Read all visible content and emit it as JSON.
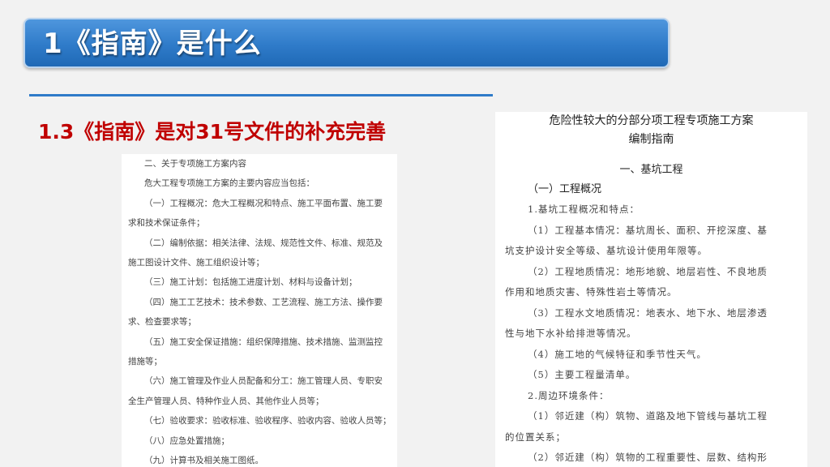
{
  "slide": {
    "title": "1《指南》是什么",
    "subtitle": "1.3《指南》是对31号文件的补充完善"
  },
  "left_doc": {
    "lines": [
      {
        "text": "二、关于专项施工方案内容",
        "indent": true
      },
      {
        "text": "危大工程专项施工方案的主要内容应当包括：",
        "indent": true
      },
      {
        "text": "（一）工程概况：危大工程概况和特点、施工平面布置、施工要",
        "indent": true
      },
      {
        "text": "求和技术保证条件；",
        "indent": false
      },
      {
        "text": "（二）编制依据：相关法律、法规、规范性文件、标准、规范及",
        "indent": true
      },
      {
        "text": "施工图设计文件、施工组织设计等；",
        "indent": false
      },
      {
        "text": "（三）施工计划：包括施工进度计划、材料与设备计划；",
        "indent": true
      },
      {
        "text": "（四）施工工艺技术：技术参数、工艺流程、施工方法、操作要",
        "indent": true
      },
      {
        "text": "求、检查要求等；",
        "indent": false
      },
      {
        "text": "（五）施工安全保证措施：组织保障措施、技术措施、监测监控",
        "indent": true
      },
      {
        "text": "措施等；",
        "indent": false
      },
      {
        "text": "（六）施工管理及作业人员配备和分工：施工管理人员、专职安",
        "indent": true
      },
      {
        "text": "全生产管理人员、特种作业人员、其他作业人员等；",
        "indent": false
      },
      {
        "text": "（七）验收要求：验收标准、验收程序、验收内容、验收人员等；",
        "indent": true
      },
      {
        "text": "（八）应急处置措施；",
        "indent": true
      },
      {
        "text": "（九）计算书及相关施工图纸。",
        "indent": true
      }
    ]
  },
  "right_doc": {
    "title_line1": "危险性较大的分部分项工程专项施工方案",
    "title_line2": "编制指南",
    "section": "一、基坑工程",
    "heading": "（一）工程概况",
    "lines": [
      {
        "text": "1.基坑工程概况和特点：",
        "indent": true
      },
      {
        "text": "（1）工程基本情况：基坑周长、面积、开挖深度、基",
        "indent": true
      },
      {
        "text": "坑支护设计安全等级、基坑设计使用年限等。",
        "indent": false
      },
      {
        "text": "（2）工程地质情况：地形地貌、地层岩性、不良地质",
        "indent": true
      },
      {
        "text": "作用和地质灾害、特殊性岩土等情况。",
        "indent": false
      },
      {
        "text": "（3）工程水文地质情况：地表水、地下水、地层渗透",
        "indent": true
      },
      {
        "text": "性与地下水补给排泄等情况。",
        "indent": false
      },
      {
        "text": "（4）施工地的气候特征和季节性天气。",
        "indent": true
      },
      {
        "text": "（5）主要工程量清单。",
        "indent": true
      },
      {
        "text": "2.周边环境条件：",
        "indent": true
      },
      {
        "text": "（1）邻近建（构）筑物、道路及地下管线与基坑工程",
        "indent": true
      },
      {
        "text": "的位置关系；",
        "indent": false
      },
      {
        "text": "（2）邻近建（构）筑物的工程重要性、层数、结构形",
        "indent": true
      }
    ]
  }
}
